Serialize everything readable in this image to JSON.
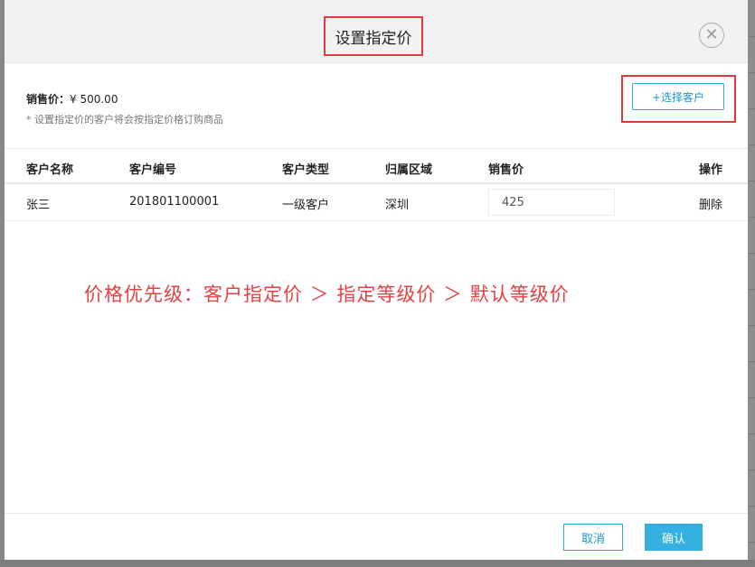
{
  "dialog": {
    "title": "设置指定价",
    "close_icon": "close-icon"
  },
  "summary": {
    "price_label": "销售价：",
    "price_value": "¥ 500.00",
    "note": "* 设置指定价的客户将会按指定价格订购商品"
  },
  "toolbar": {
    "select_customer_label": "+选择客户"
  },
  "table": {
    "columns": [
      "客户名称",
      "客户编号",
      "客户类型",
      "归属区域",
      "销售价",
      "操作"
    ],
    "rows": [
      {
        "name": "张三",
        "code": "201801100001",
        "type": "一级客户",
        "region": "深圳",
        "price": "425",
        "action": "删除"
      }
    ]
  },
  "annotation": {
    "text": "价格优先级：客户指定价 ＞ 指定等级价 ＞ 默认等级价",
    "color": "#e24242"
  },
  "footer": {
    "cancel_label": "取消",
    "confirm_label": "确认"
  },
  "colors": {
    "accent": "#35b0e0",
    "highlight": "#e03a3a"
  }
}
